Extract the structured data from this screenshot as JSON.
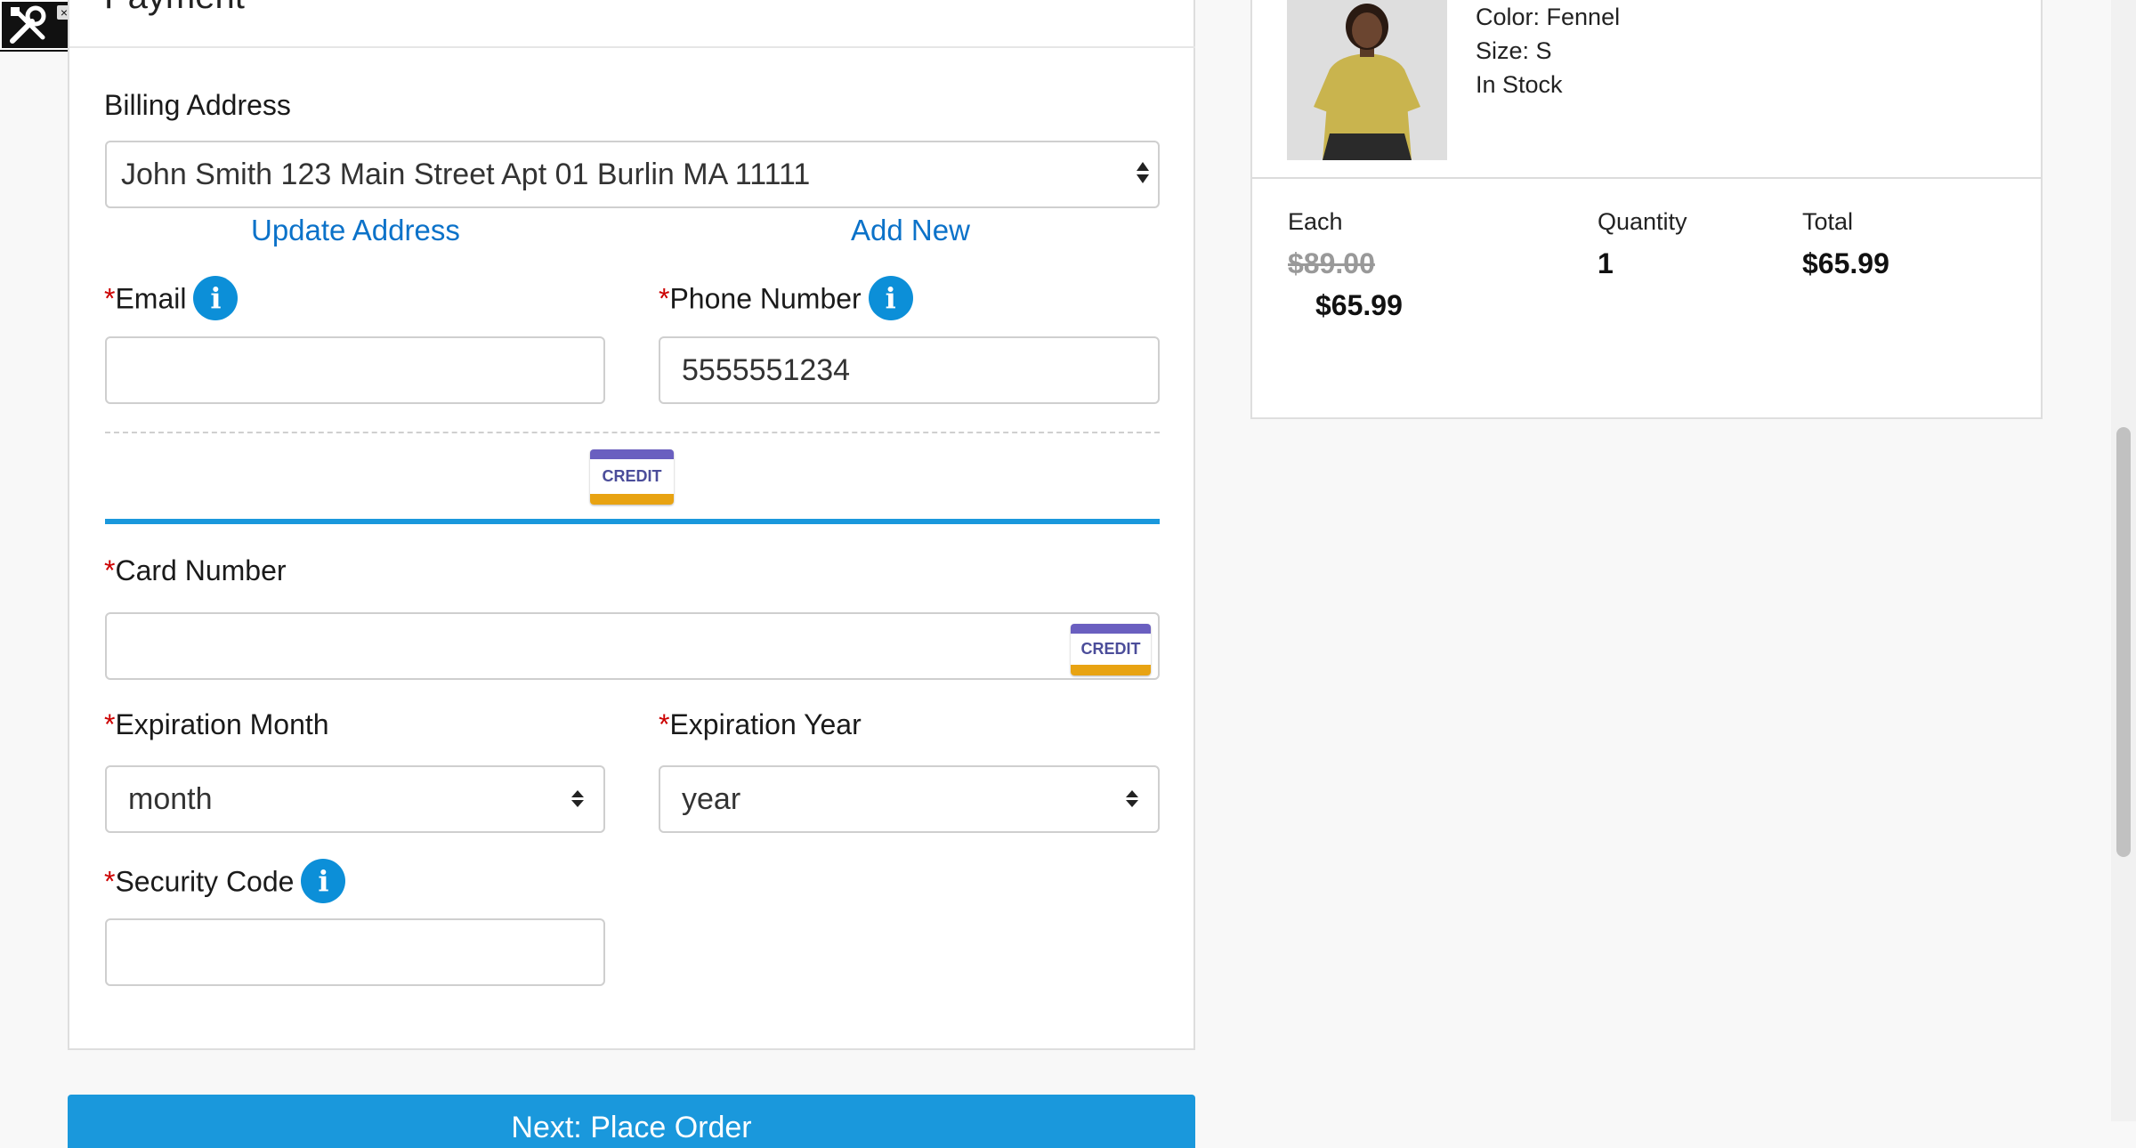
{
  "payment": {
    "title": "Payment",
    "billing_label": "Billing Address",
    "billing_value": "John Smith 123 Main Street Apt 01 Burlin MA 11111",
    "update_address": "Update Address",
    "add_new": "Add New",
    "required_mark": "*",
    "email_label": "Email",
    "email_value": "",
    "phone_label": "Phone Number",
    "phone_value": "5555551234",
    "info_glyph": "i",
    "card_type_label": "CREDIT",
    "card_number_label": "Card Number",
    "card_number_value": "",
    "exp_month_label": "Expiration Month",
    "exp_month_value": "month",
    "exp_year_label": "Expiration Year",
    "exp_year_value": "year",
    "security_label": "Security Code",
    "security_value": "",
    "place_order_label": "Next: Place Order"
  },
  "summary": {
    "color": "Color: Fennel",
    "size": "Size: S",
    "stock": "In Stock",
    "each_label": "Each",
    "quantity_label": "Quantity",
    "total_label": "Total",
    "original_price": "$89.00",
    "sale_price": "$65.99",
    "quantity": "1",
    "total": "$65.99"
  },
  "colors": {
    "accent": "#1a98dc",
    "link": "#0b72c9",
    "required": "#cc0000",
    "credit_top": "#6a5fc0",
    "credit_bottom": "#e8a312"
  }
}
